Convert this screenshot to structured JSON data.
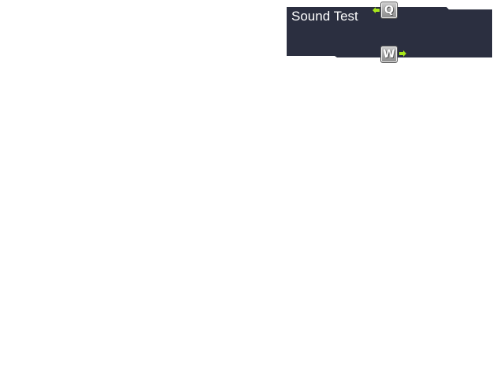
{
  "panel": {
    "title": "Sound Test",
    "background_color": "#2b2f40",
    "accent_color": "#a8e81c"
  },
  "controls": {
    "prev_key": {
      "letter": "Q",
      "icon": "arrow-left-icon"
    },
    "next_key": {
      "letter": "W",
      "icon": "arrow-right-icon"
    }
  }
}
